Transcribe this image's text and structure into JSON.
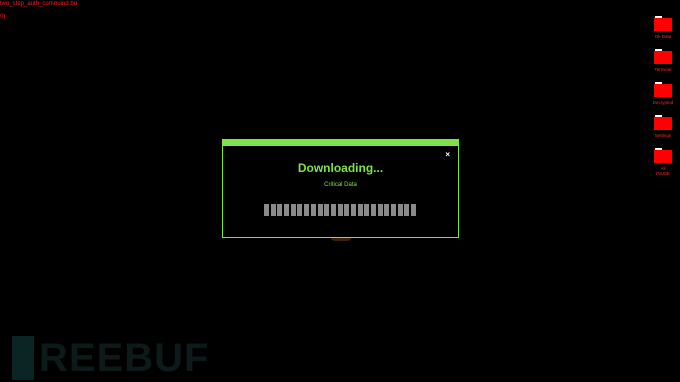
{
  "top_text": {
    "line1": "two_step_auth_command.bu",
    "line2": "0)"
  },
  "desktop_icons": [
    {
      "label": "Ok Data",
      "icon": "folder-icon"
    },
    {
      "label": "Terminal",
      "icon": "folder-icon"
    },
    {
      "label": "Decrypted",
      "icon": "folder-icon"
    },
    {
      "label": "Settings",
      "icon": "folder-icon"
    },
    {
      "label": "All\nINUSE",
      "icon": "folder-icon"
    }
  ],
  "dialog": {
    "title": "Downloading...",
    "subtitle": "Critical Data",
    "close": "×",
    "progress_segments_filled": 23,
    "progress_segments_total": 23
  },
  "watermark": {
    "text": "REEBUF"
  },
  "colors": {
    "background": "#000000",
    "accent_green": "#7ee24a",
    "text_red": "#ff1a1a",
    "folder_red": "#ff0000",
    "progress_gray": "#8a8a8a"
  }
}
